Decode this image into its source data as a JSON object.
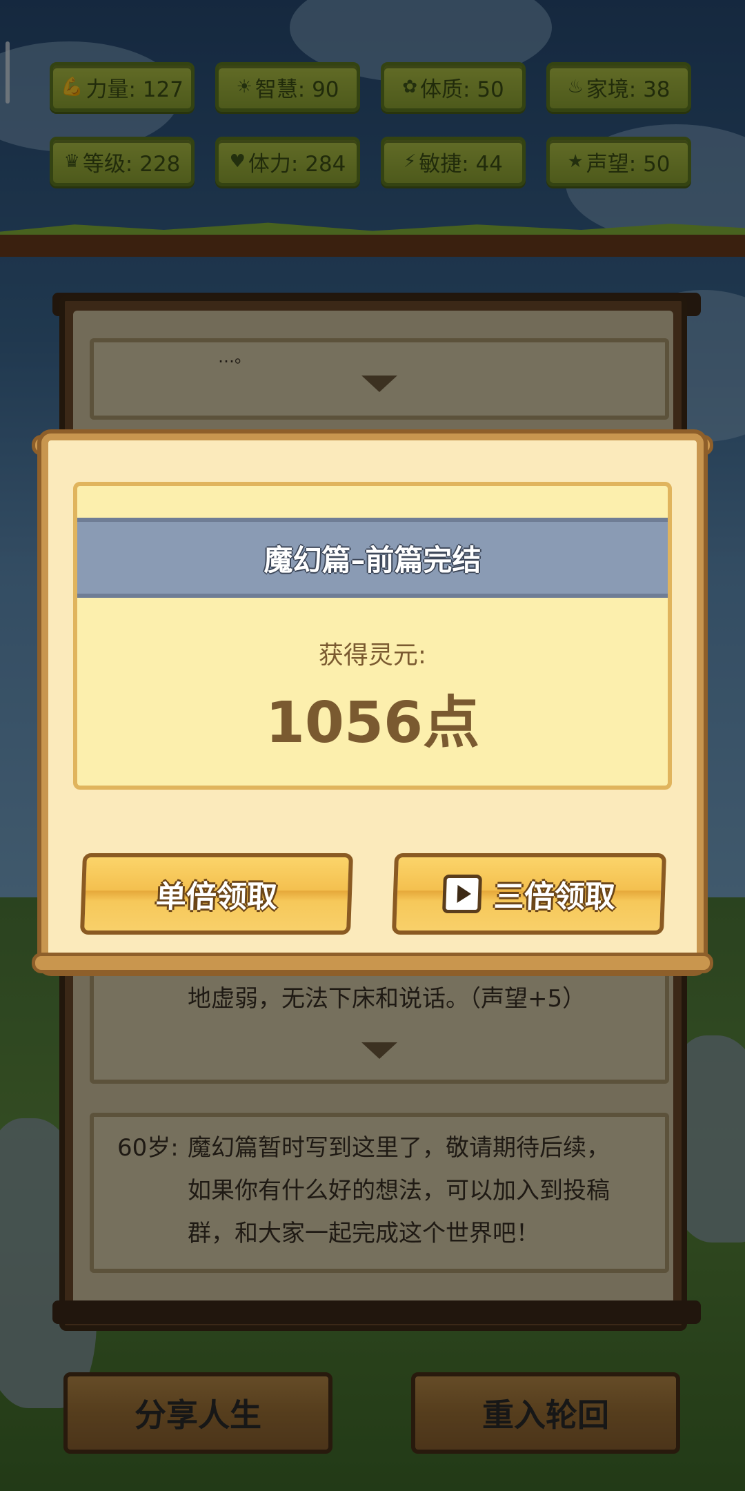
{
  "stats": [
    {
      "icon": "strength-icon",
      "glyph": "💪",
      "text": "力量: 127"
    },
    {
      "icon": "wisdom-icon",
      "glyph": "☀",
      "text": "智慧: 90"
    },
    {
      "icon": "constitution-icon",
      "glyph": "✿",
      "text": "体质: 50"
    },
    {
      "icon": "family-icon",
      "glyph": "♨",
      "text": "家境: 38"
    },
    {
      "icon": "level-icon",
      "glyph": "♛",
      "text": "等级: 228"
    },
    {
      "icon": "stamina-icon",
      "glyph": "♥",
      "text": "体力: 284"
    },
    {
      "icon": "agility-icon",
      "glyph": "⚡",
      "text": "敏捷: 44"
    },
    {
      "icon": "reputation-icon",
      "glyph": "★",
      "text": "声望: 50"
    }
  ],
  "log": {
    "top_partial": "…。",
    "mid_text": "地虚弱，无法下床和说话。（声望+5）",
    "last_age": "60岁:",
    "last_lines": [
      "魔幻篇暂时写到这里了，敬请期待后续，",
      "如果你有什么好的想法，可以加入到投稿",
      "群，和大家一起完成这个世界吧！"
    ]
  },
  "modal": {
    "title": "魔幻篇–前篇完结",
    "reward_label": "获得灵元:",
    "reward_value": "1056点",
    "single_button": "单倍领取",
    "triple_button": "三倍领取"
  },
  "bottom": {
    "share_button": "分享人生",
    "restart_button": "重入轮回"
  }
}
